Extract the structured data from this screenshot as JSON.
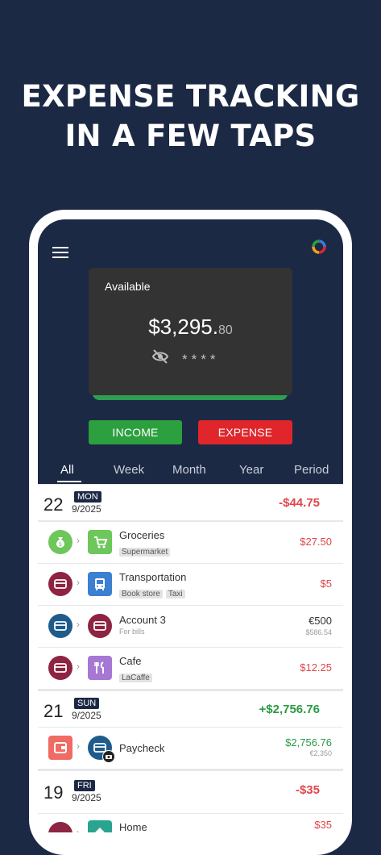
{
  "headline": {
    "line1": "EXPENSE TRACKING",
    "line2": "IN A FEW TAPS"
  },
  "colors": {
    "background": "#1c2945",
    "income": "#2ca03e",
    "expense": "#e0262a",
    "card": "#333333"
  },
  "balance_card": {
    "title": "Available",
    "amount": "$3,295.",
    "cents": "80",
    "hidden_mask": "****"
  },
  "buttons": {
    "income": "INCOME",
    "expense": "EXPENSE"
  },
  "tabs": [
    "All",
    "Week",
    "Month",
    "Year",
    "Period"
  ],
  "active_tab": "All",
  "days": [
    {
      "day": "22",
      "weekday": "MON",
      "date": "9/2025",
      "total": "-$44.75",
      "transactions": [
        {
          "name": "Groceries",
          "tags": [
            "Supermarket"
          ],
          "amount": "$27.50"
        },
        {
          "name": "Transportation",
          "tags": [
            "Book store",
            "Taxi"
          ],
          "amount": "$5"
        },
        {
          "name": "Account 3",
          "note": "For bills",
          "amount": "€500",
          "sub_amount": "$586.54"
        },
        {
          "name": "Cafe",
          "tags": [
            "LaCaffe"
          ],
          "amount": "$12.25"
        }
      ]
    },
    {
      "day": "21",
      "weekday": "SUN",
      "date": "9/2025",
      "total": "+$2,756.76",
      "transactions": [
        {
          "name": "Paycheck",
          "amount": "$2,756.76",
          "sub_amount": "€2,350"
        }
      ]
    },
    {
      "day": "19",
      "weekday": "FRI",
      "date": "9/2025",
      "total": "-$35",
      "transactions": [
        {
          "name": "Home",
          "amount": "$35"
        }
      ]
    }
  ]
}
